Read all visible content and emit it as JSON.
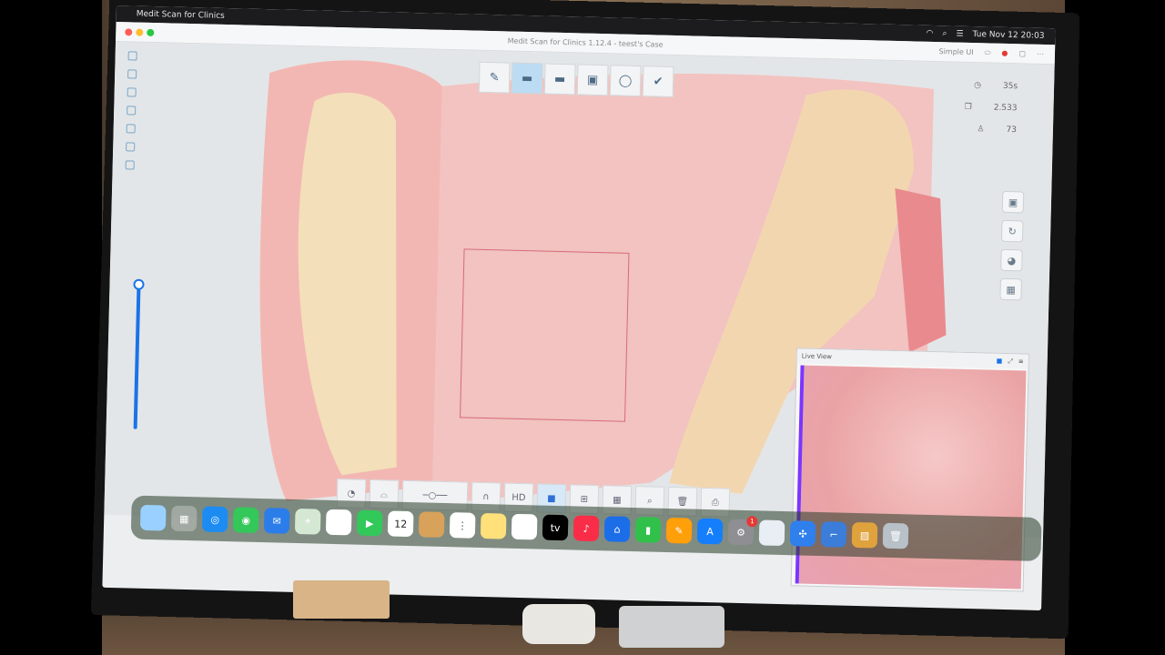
{
  "menubar": {
    "app_name": "Medit Scan for Clinics",
    "datetime": "Tue Nov 12  20:03"
  },
  "titlebar": {
    "title": "Medit Scan for Clinics 1.12.4 - teest's Case",
    "mode": "Simple UI"
  },
  "stats": {
    "time": "35s",
    "value2": "2.533",
    "value3": "73"
  },
  "live_view": {
    "title": "Live View"
  },
  "dock": {
    "calendar_date": "12",
    "badge_count": "1"
  },
  "colors": {
    "accent": "#1a73e8",
    "live_view_edge": "#7b35ff",
    "scan_frame": "#d76a7a"
  }
}
